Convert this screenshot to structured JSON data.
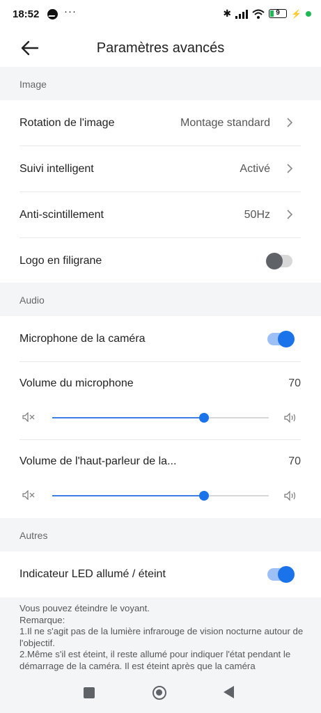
{
  "status": {
    "time": "18:52",
    "battery": "9"
  },
  "header": {
    "title": "Paramètres avancés"
  },
  "sections": {
    "image": {
      "label": "Image",
      "rotation": {
        "label": "Rotation de l'image",
        "value": "Montage standard"
      },
      "tracking": {
        "label": "Suivi intelligent",
        "value": "Activé"
      },
      "flicker": {
        "label": "Anti-scintillement",
        "value": "50Hz"
      },
      "watermark": {
        "label": "Logo en filigrane",
        "enabled": false
      }
    },
    "audio": {
      "label": "Audio",
      "mic": {
        "label": "Microphone de la caméra",
        "enabled": true
      },
      "mic_volume": {
        "label": "Volume du microphone",
        "value": "70",
        "level": 70
      },
      "speaker_volume": {
        "label": "Volume de l'haut-parleur de la...",
        "value": "70",
        "level": 70
      }
    },
    "others": {
      "label": "Autres",
      "led": {
        "label": "Indicateur LED allumé / éteint",
        "enabled": true
      },
      "note": {
        "l1": "Vous pouvez éteindre le voyant.",
        "l2": "Remarque:",
        "l3": "1.Il ne s'agit pas de la lumière infrarouge de vision nocturne autour de l'objectif.",
        "l4": "2.Même s'il est éteint, il reste allumé pour indiquer l'état pendant le démarrage de la caméra. Il est éteint après que la caméra"
      }
    }
  },
  "colors": {
    "accent": "#1a73e8",
    "toggle_on_track": "#9cc0f6",
    "toggle_off_knob": "#5f6368"
  }
}
